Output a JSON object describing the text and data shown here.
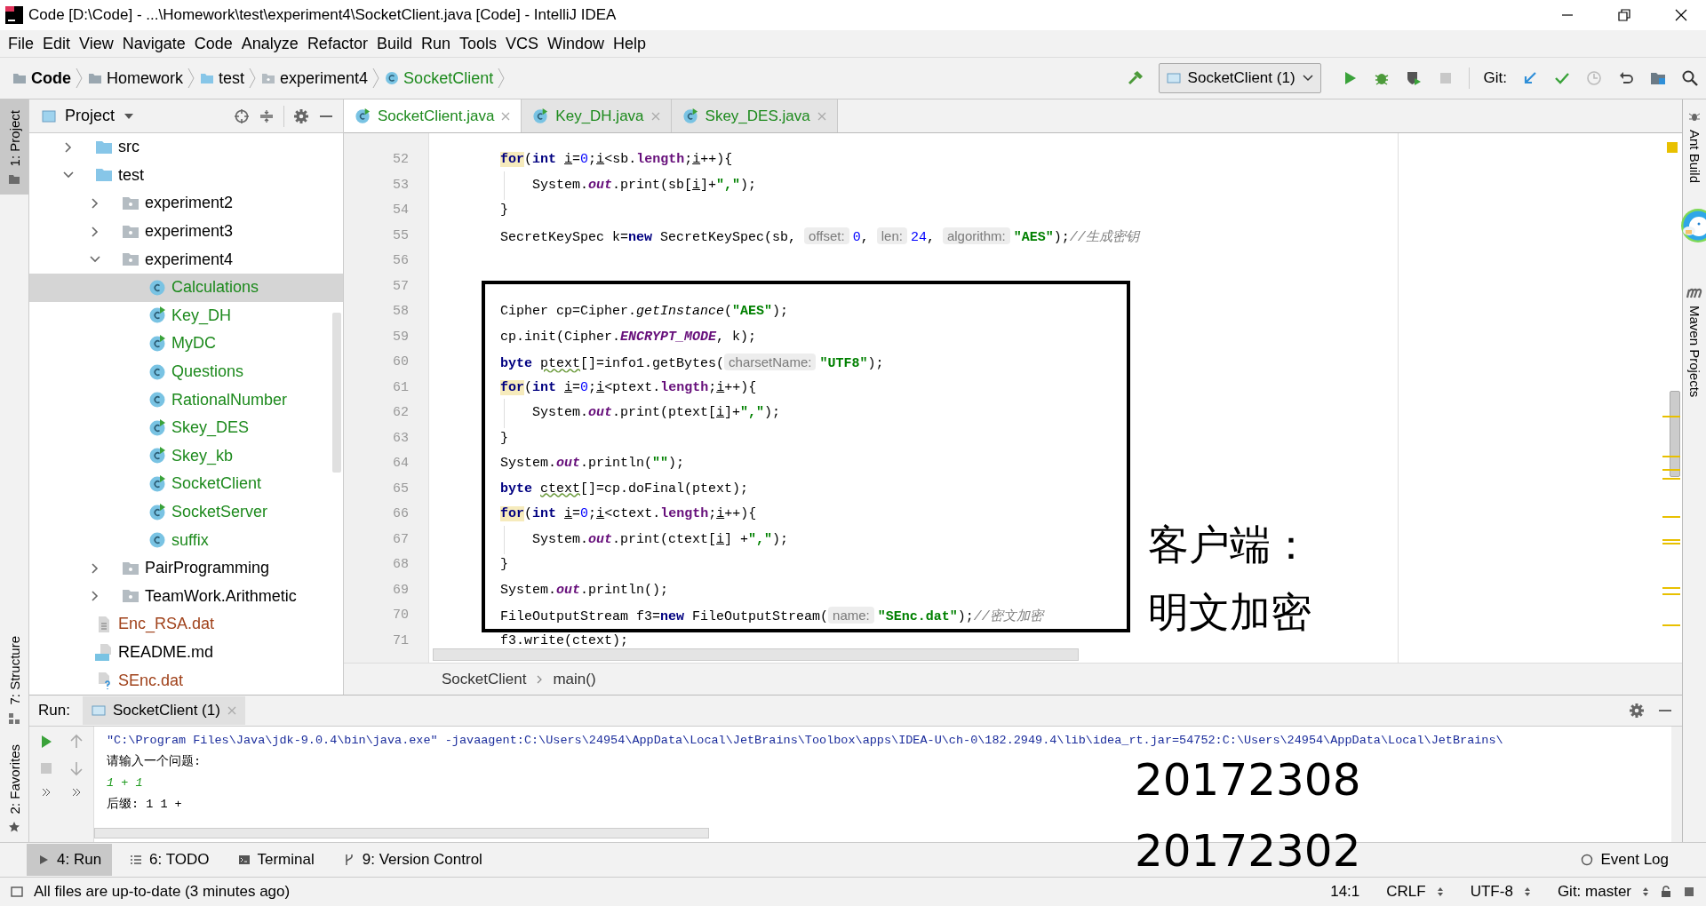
{
  "window": {
    "title": "Code [D:\\Code] - ...\\Homework\\test\\experiment4\\SocketClient.java [Code] - IntelliJ IDEA"
  },
  "menu": [
    "File",
    "Edit",
    "View",
    "Navigate",
    "Code",
    "Analyze",
    "Refactor",
    "Build",
    "Run",
    "Tools",
    "VCS",
    "Window",
    "Help"
  ],
  "breadcrumbs": [
    {
      "label": "Code",
      "kind": "root"
    },
    {
      "label": "Homework",
      "kind": "folder"
    },
    {
      "label": "test",
      "kind": "source_folder"
    },
    {
      "label": "experiment4",
      "kind": "package"
    },
    {
      "label": "SocketClient",
      "kind": "class"
    }
  ],
  "run_config": {
    "label": "SocketClient (1)"
  },
  "git_label": "Git:",
  "left_stripe": [
    {
      "label": "1: Project",
      "selected": true
    },
    {
      "label": "7: Structure",
      "selected": false
    }
  ],
  "favorites_stripe": {
    "label": "2: Favorites",
    "selected": false
  },
  "right_stripe": [
    {
      "label": "Ant Build"
    },
    {
      "label": "Maven Projects"
    }
  ],
  "project_panel": {
    "title": "Project",
    "tree": [
      {
        "label": "src",
        "kind": "source_folder",
        "expanded": false,
        "selected": false
      },
      {
        "label": "test",
        "kind": "source_folder",
        "expanded": true,
        "selected": false,
        "children": [
          {
            "label": "experiment2",
            "kind": "package",
            "expanded": false,
            "selected": false
          },
          {
            "label": "experiment3",
            "kind": "package",
            "expanded": false,
            "selected": false
          },
          {
            "label": "experiment4",
            "kind": "package",
            "expanded": true,
            "selected": false,
            "children": [
              {
                "label": "Calculations",
                "kind": "class",
                "selected": true
              },
              {
                "label": "Key_DH",
                "kind": "runnable_class",
                "selected": false
              },
              {
                "label": "MyDC",
                "kind": "runnable_class",
                "selected": false
              },
              {
                "label": "Questions",
                "kind": "class",
                "selected": false
              },
              {
                "label": "RationalNumber",
                "kind": "class",
                "selected": false
              },
              {
                "label": "Skey_DES",
                "kind": "runnable_class",
                "selected": false
              },
              {
                "label": "Skey_kb",
                "kind": "runnable_class",
                "selected": false
              },
              {
                "label": "SocketClient",
                "kind": "runnable_class",
                "selected": false
              },
              {
                "label": "SocketServer",
                "kind": "runnable_class",
                "selected": false
              },
              {
                "label": "suffix",
                "kind": "class",
                "selected": false
              }
            ]
          },
          {
            "label": "PairProgramming",
            "kind": "package",
            "expanded": false,
            "selected": false
          },
          {
            "label": "TeamWork.Arithmetic",
            "kind": "package",
            "expanded": false,
            "selected": false
          }
        ]
      },
      {
        "label": "Enc_RSA.dat",
        "kind": "data_file",
        "selected": false
      },
      {
        "label": "README.md",
        "kind": "markdown_file",
        "selected": false
      },
      {
        "label": "SEnc.dat",
        "kind": "unknown_file",
        "selected": false
      }
    ]
  },
  "editor_tabs": [
    {
      "label": "SocketClient.java",
      "selected": true
    },
    {
      "label": "Key_DH.java",
      "selected": false
    },
    {
      "label": "Skey_DES.java",
      "selected": false
    }
  ],
  "code_lines": [
    {
      "number": "52",
      "indented": false,
      "tokens": [
        {
          "kind": "keyword_marked",
          "text": "for"
        },
        {
          "kind": "plain",
          "text": "("
        },
        {
          "kind": "keyword",
          "text": "int "
        },
        {
          "kind": "var",
          "text": "i"
        },
        {
          "kind": "plain",
          "text": "="
        },
        {
          "kind": "number",
          "text": "0"
        },
        {
          "kind": "plain",
          "text": ";"
        },
        {
          "kind": "var",
          "text": "i"
        },
        {
          "kind": "plain",
          "text": "<sb."
        },
        {
          "kind": "field",
          "text": "length"
        },
        {
          "kind": "plain",
          "text": ";"
        },
        {
          "kind": "var",
          "text": "i"
        },
        {
          "kind": "plain",
          "text": "++){"
        }
      ]
    },
    {
      "number": "53",
      "indented": true,
      "tokens": [
        {
          "kind": "plain",
          "text": "System."
        },
        {
          "kind": "static",
          "text": "out"
        },
        {
          "kind": "plain",
          "text": ".print(sb["
        },
        {
          "kind": "var",
          "text": "i"
        },
        {
          "kind": "plain",
          "text": "]+"
        },
        {
          "kind": "string",
          "text": "\",\""
        },
        {
          "kind": "plain",
          "text": ");"
        }
      ]
    },
    {
      "number": "54",
      "indented": false,
      "tokens": [
        {
          "kind": "plain",
          "text": "}"
        }
      ]
    },
    {
      "number": "55",
      "indented": false,
      "tokens": [
        {
          "kind": "plain",
          "text": "SecretKeySpec k="
        },
        {
          "kind": "keyword",
          "text": "new"
        },
        {
          "kind": "plain",
          "text": " SecretKeySpec(sb, "
        },
        {
          "kind": "hint",
          "text": "offset:"
        },
        {
          "kind": "number",
          "text": "0"
        },
        {
          "kind": "plain",
          "text": ", "
        },
        {
          "kind": "hint",
          "text": "len:"
        },
        {
          "kind": "number",
          "text": "24"
        },
        {
          "kind": "plain",
          "text": ", "
        },
        {
          "kind": "hint",
          "text": "algorithm:"
        },
        {
          "kind": "string",
          "text": "\"AES\""
        },
        {
          "kind": "plain",
          "text": ");"
        },
        {
          "kind": "comment",
          "text": "//生成密钥"
        }
      ]
    },
    {
      "number": "56",
      "indented": false
    },
    {
      "number": "57",
      "indented": false
    },
    {
      "number": "58",
      "indented": false,
      "tokens": [
        {
          "kind": "plain",
          "text": "Cipher cp=Cipher."
        },
        {
          "kind": "method",
          "text": "getInstance"
        },
        {
          "kind": "plain",
          "text": "("
        },
        {
          "kind": "string",
          "text": "\"AES\""
        },
        {
          "kind": "plain",
          "text": ");"
        }
      ]
    },
    {
      "number": "59",
      "indented": false,
      "tokens": [
        {
          "kind": "plain",
          "text": "cp.init(Cipher."
        },
        {
          "kind": "static",
          "text": "ENCRYPT_MODE"
        },
        {
          "kind": "plain",
          "text": ", k);"
        }
      ]
    },
    {
      "number": "60",
      "indented": false,
      "tokens": [
        {
          "kind": "keyword",
          "text": "byte "
        },
        {
          "kind": "warn",
          "text": "ptext"
        },
        {
          "kind": "plain",
          "text": "[]=info1.getBytes("
        },
        {
          "kind": "hint",
          "text": "charsetName:"
        },
        {
          "kind": "string",
          "text": "\"UTF8\""
        },
        {
          "kind": "plain",
          "text": ");"
        }
      ]
    },
    {
      "number": "61",
      "indented": false,
      "tokens": [
        {
          "kind": "keyword_marked",
          "text": "for"
        },
        {
          "kind": "plain",
          "text": "("
        },
        {
          "kind": "keyword",
          "text": "int "
        },
        {
          "kind": "var",
          "text": "i"
        },
        {
          "kind": "plain",
          "text": "="
        },
        {
          "kind": "number",
          "text": "0"
        },
        {
          "kind": "plain",
          "text": ";"
        },
        {
          "kind": "var",
          "text": "i"
        },
        {
          "kind": "plain",
          "text": "<ptext."
        },
        {
          "kind": "field",
          "text": "length"
        },
        {
          "kind": "plain",
          "text": ";"
        },
        {
          "kind": "var",
          "text": "i"
        },
        {
          "kind": "plain",
          "text": "++){"
        }
      ]
    },
    {
      "number": "62",
      "indented": true,
      "tokens": [
        {
          "kind": "plain",
          "text": "System."
        },
        {
          "kind": "static",
          "text": "out"
        },
        {
          "kind": "plain",
          "text": ".print(ptext["
        },
        {
          "kind": "var",
          "text": "i"
        },
        {
          "kind": "plain",
          "text": "]+"
        },
        {
          "kind": "string",
          "text": "\",\""
        },
        {
          "kind": "plain",
          "text": ");"
        }
      ]
    },
    {
      "number": "63",
      "indented": false,
      "tokens": [
        {
          "kind": "plain",
          "text": "}"
        }
      ]
    },
    {
      "number": "64",
      "indented": false,
      "tokens": [
        {
          "kind": "plain",
          "text": "System."
        },
        {
          "kind": "static",
          "text": "out"
        },
        {
          "kind": "plain",
          "text": ".println("
        },
        {
          "kind": "string",
          "text": "\"\""
        },
        {
          "kind": "plain",
          "text": ");"
        }
      ]
    },
    {
      "number": "65",
      "indented": false,
      "tokens": [
        {
          "kind": "keyword",
          "text": "byte "
        },
        {
          "kind": "warn",
          "text": "ctext"
        },
        {
          "kind": "plain",
          "text": "[]=cp.doFinal(ptext);"
        }
      ]
    },
    {
      "number": "66",
      "indented": false,
      "tokens": [
        {
          "kind": "keyword_marked",
          "text": "for"
        },
        {
          "kind": "plain",
          "text": "("
        },
        {
          "kind": "keyword",
          "text": "int "
        },
        {
          "kind": "var",
          "text": "i"
        },
        {
          "kind": "plain",
          "text": "="
        },
        {
          "kind": "number",
          "text": "0"
        },
        {
          "kind": "plain",
          "text": ";"
        },
        {
          "kind": "var",
          "text": "i"
        },
        {
          "kind": "plain",
          "text": "<ctext."
        },
        {
          "kind": "field",
          "text": "length"
        },
        {
          "kind": "plain",
          "text": ";"
        },
        {
          "kind": "var",
          "text": "i"
        },
        {
          "kind": "plain",
          "text": "++){"
        }
      ]
    },
    {
      "number": "67",
      "indented": true,
      "tokens": [
        {
          "kind": "plain",
          "text": "System."
        },
        {
          "kind": "static",
          "text": "out"
        },
        {
          "kind": "plain",
          "text": ".print(ctext["
        },
        {
          "kind": "var",
          "text": "i"
        },
        {
          "kind": "plain",
          "text": "] +"
        },
        {
          "kind": "string",
          "text": "\",\""
        },
        {
          "kind": "plain",
          "text": ");"
        }
      ]
    },
    {
      "number": "68",
      "indented": false,
      "tokens": [
        {
          "kind": "plain",
          "text": "}"
        }
      ]
    },
    {
      "number": "69",
      "indented": false,
      "tokens": [
        {
          "kind": "plain",
          "text": "System."
        },
        {
          "kind": "static",
          "text": "out"
        },
        {
          "kind": "plain",
          "text": ".println();"
        }
      ]
    },
    {
      "number": "70",
      "indented": false,
      "tokens": [
        {
          "kind": "plain",
          "text": "FileOutputStream f3="
        },
        {
          "kind": "keyword",
          "text": "new"
        },
        {
          "kind": "plain",
          "text": " FileOutputStream("
        },
        {
          "kind": "hint",
          "text": "name:"
        },
        {
          "kind": "string",
          "text": "\"SEnc.dat\""
        },
        {
          "kind": "plain",
          "text": ");"
        },
        {
          "kind": "comment",
          "text": "//密文加密"
        }
      ]
    },
    {
      "number": "71",
      "indented": false,
      "tokens": [
        {
          "kind": "plain",
          "text": "f3.write(ctext);"
        }
      ]
    }
  ],
  "editor_breadcrumbs": [
    "SocketClient",
    "main()"
  ],
  "annotation": {
    "caption_lines": [
      "客户端：",
      "明文加密"
    ],
    "student_ids": [
      "20172308",
      "20172302"
    ]
  },
  "run_panel": {
    "label": "Run:",
    "tab": "SocketClient (1)",
    "console": [
      {
        "kind": "command",
        "text": "\"C:\\Program Files\\Java\\jdk-9.0.4\\bin\\java.exe\" -javaagent:C:\\Users\\24954\\AppData\\Local\\JetBrains\\Toolbox\\apps\\IDEA-U\\ch-0\\182.2949.4\\lib\\idea_rt.jar=54752:C:\\Users\\24954\\AppData\\Local\\JetBrains\\"
      },
      {
        "kind": "output",
        "text": "请输入一个问题:"
      },
      {
        "kind": "input",
        "text": "1 + 1"
      },
      {
        "kind": "output",
        "text": "后缀: 1 1 +"
      }
    ]
  },
  "tool_windows": [
    {
      "label": "4: Run",
      "kind": "run",
      "selected": true
    },
    {
      "label": "6: TODO",
      "kind": "todo",
      "selected": false
    },
    {
      "label": "Terminal",
      "kind": "terminal",
      "selected": false
    },
    {
      "label": "9: Version Control",
      "kind": "vcs",
      "selected": false
    }
  ],
  "event_log": "Event Log",
  "status_bar": {
    "message": "All files are up-to-date (3 minutes ago)",
    "position": "14:1",
    "line_separator": "CRLF",
    "encoding": "UTF-8",
    "branch": "Git: master"
  }
}
